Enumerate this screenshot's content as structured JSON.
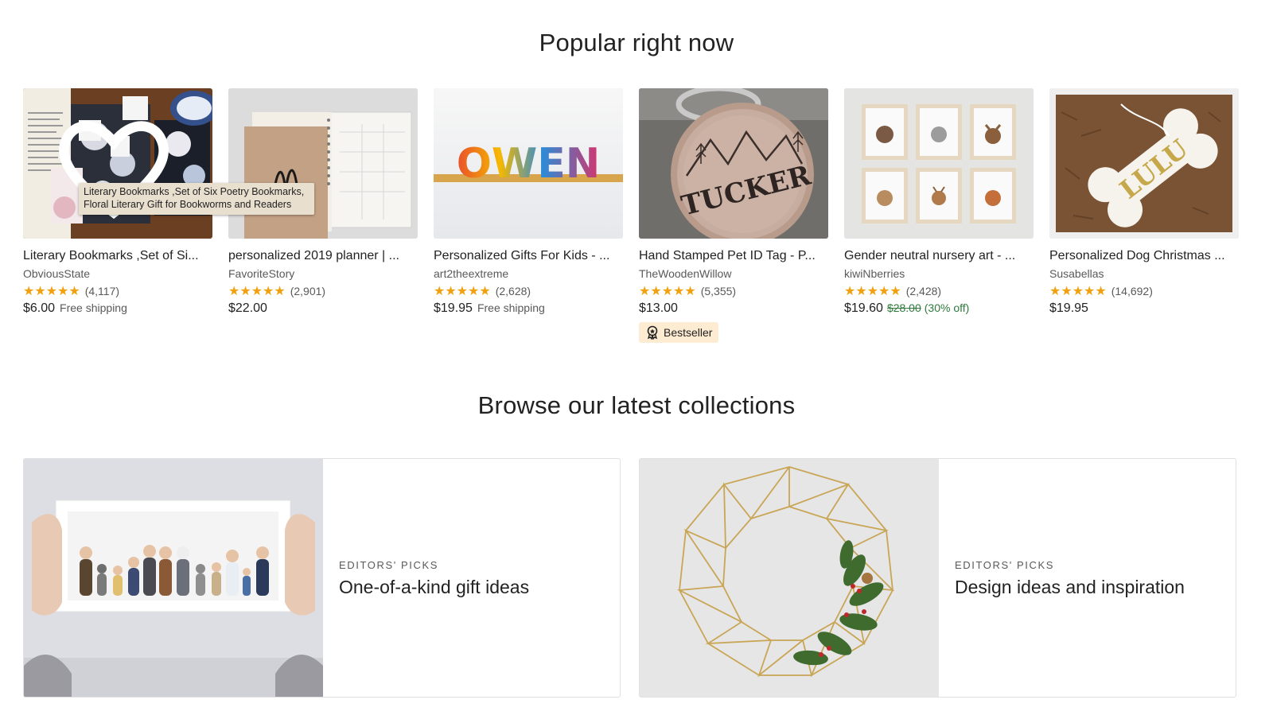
{
  "popular": {
    "title": "Popular right now",
    "products": [
      {
        "title": "Literary Bookmarks ,Set of Si...",
        "shop": "ObviousState",
        "stars": "★★★★★",
        "reviews": "(4,117)",
        "price": "$6.00",
        "shipping": "Free shipping",
        "tooltip": "Literary Bookmarks ,Set of Six Poetry Bookmarks, Floral Literary Gift for Bookworms and Readers"
      },
      {
        "title": "personalized 2019 planner | ...",
        "shop": "FavoriteStory",
        "stars": "★★★★★",
        "reviews": "(2,901)",
        "price": "$22.00"
      },
      {
        "title": "Personalized Gifts For Kids - ...",
        "shop": "art2theextreme",
        "stars": "★★★★★",
        "reviews": "(2,628)",
        "price": "$19.95",
        "shipping": "Free shipping",
        "image_text": "OWEN"
      },
      {
        "title": "Hand Stamped Pet ID Tag - P...",
        "shop": "TheWoodenWillow",
        "stars": "★★★★★",
        "reviews": "(5,355)",
        "price": "$13.00",
        "badge": "Bestseller",
        "image_text": "TUCKER"
      },
      {
        "title": "Gender neutral nursery art - ...",
        "shop": "kiwiNberries",
        "stars": "★★★★★",
        "reviews": "(2,428)",
        "price": "$19.60",
        "old_price": "$28.00",
        "discount": "(30% off)"
      },
      {
        "title": "Personalized Dog Christmas ...",
        "shop": "Susabellas",
        "stars": "★★★★★",
        "reviews": "(14,692)",
        "price": "$19.95",
        "image_text": "LULU"
      }
    ]
  },
  "browse": {
    "title": "Browse our latest collections",
    "collections": [
      {
        "kicker": "EDITORS' PICKS",
        "title": "One-of-a-kind gift ideas"
      },
      {
        "kicker": "EDITORS' PICKS",
        "title": "Design ideas and inspiration"
      }
    ]
  },
  "icons": {
    "favorite": "heart-icon",
    "bestseller": "award-icon"
  },
  "colors": {
    "star": "#f1a10d",
    "discount": "#2f7a3c",
    "badge_bg": "#fdebd2"
  }
}
